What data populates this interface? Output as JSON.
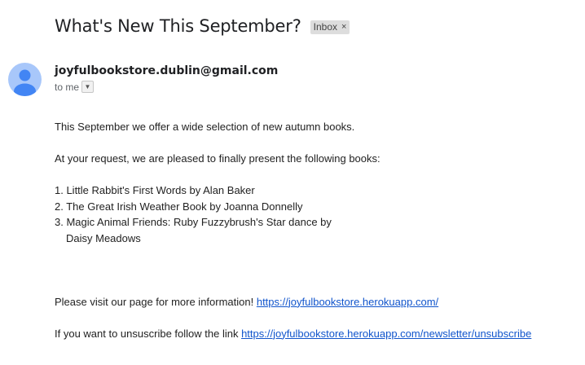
{
  "email": {
    "subject": "What's New This September?",
    "label": "Inbox",
    "label_close_glyph": "×",
    "sender": "joyfulbookstore.dublin@gmail.com",
    "recipient": "to me",
    "dropdown_icon": "caret-down",
    "body": {
      "intro": "This September we offer a wide selection of new autumn books.",
      "request": "At your request, we are pleased to finally present the following books:",
      "books": [
        "1.  Little Rabbit's First Words by Alan Baker",
        "2. The Great Irish Weather Book by Joanna Donnelly",
        "3. Magic Animal Friends: Ruby Fuzzybrush's Star dance by",
        "Daisy Meadows"
      ],
      "visit_text": "Please visit our page for more information! ",
      "visit_link": "https://joyfulbookstore.herokuapp.com/",
      "unsub_text": "If you want to unsuscribe follow the link ",
      "unsub_link": "https://joyfulbookstore.herokuapp.com/newsletter/unsubscribe"
    }
  },
  "colors": {
    "avatar_bg": "#a8c7fa",
    "avatar_fg": "#4285f4",
    "link": "#1155cc"
  }
}
